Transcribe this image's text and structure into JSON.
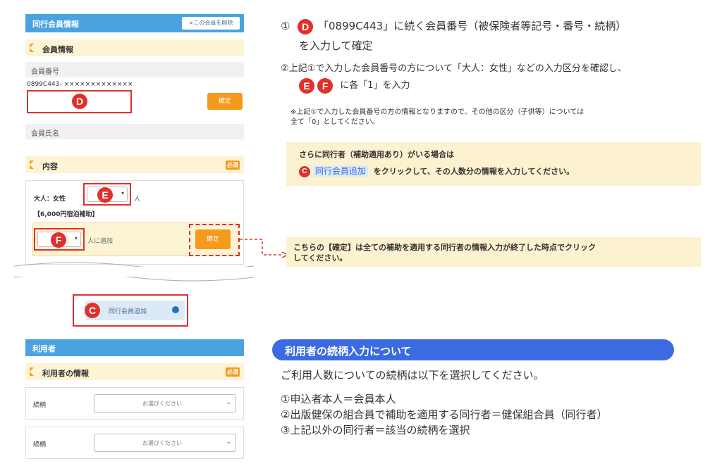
{
  "companion": {
    "header": "同行会員情報",
    "delete_button": "×この会員を削除",
    "section_member_info": "会員情報",
    "member_no_label": "会員番号",
    "member_no_prefix": "0899C443- ×××××××××××××",
    "confirm_button": "確定",
    "member_name_label": "会員氏名",
    "section_content": "内容",
    "required_badge": "必須",
    "adult_female_label": "大人：女性",
    "person_unit": "人",
    "subsidy_label": "【6,000円宿泊補助】",
    "add_to_person": "人に追加",
    "confirm_button_2": "確定",
    "add_companion_button": "同行会員追加"
  },
  "markers": {
    "d": "D",
    "e": "E",
    "f": "F",
    "c": "C"
  },
  "instructions": {
    "step1_num": "①",
    "step1_text": "「0899C443」に続く会員番号（被保険者等記号・番号・続柄）",
    "step1_text2": "を入力して確定",
    "step2_text": "②上記①で入力した会員番号の方について「大人：女性」などの入力区分を確認し、",
    "step2_text2": "に各「1」を入力",
    "note": "※上記①で入力した会員番号の方の情報となりますので、その他の区分（子供等）については",
    "note2": "全て「0」としてください。",
    "callout1_line1": "さらに同行者（補助適用あり）がいる場合は",
    "callout1_line2_button": "同行会員追加",
    "callout1_line2_text": "をクリックして、その人数分の情報を入力してください。",
    "callout2_line1": "こちらの【確定】は全ての補助を適用する同行者の情報入力が終了した時点でクリック",
    "callout2_line2": "してください。"
  },
  "users": {
    "header": "利用者",
    "section": "利用者の情報",
    "required_badge": "必須",
    "rows": [
      {
        "label": "続柄",
        "placeholder": "お選びください"
      },
      {
        "label": "続柄",
        "placeholder": "お選びください"
      }
    ]
  },
  "relation_info": {
    "title": "利用者の続柄入力について",
    "intro": "ご利用人数についての続柄は以下を選択してください。",
    "items": [
      "①申込者本人＝会員本人",
      "②出版健保の組合員で補助を適用する同行者＝健保組合員（同行者）",
      "③上記以外の同行者＝該当の続柄を選択"
    ]
  },
  "colors": {
    "header_blue": "#4aa3e0",
    "accent_orange": "#f59a1c",
    "marker_red": "#e0302c",
    "callout_yellow": "#fdf2cf",
    "title_blue": "#3b6be0"
  }
}
